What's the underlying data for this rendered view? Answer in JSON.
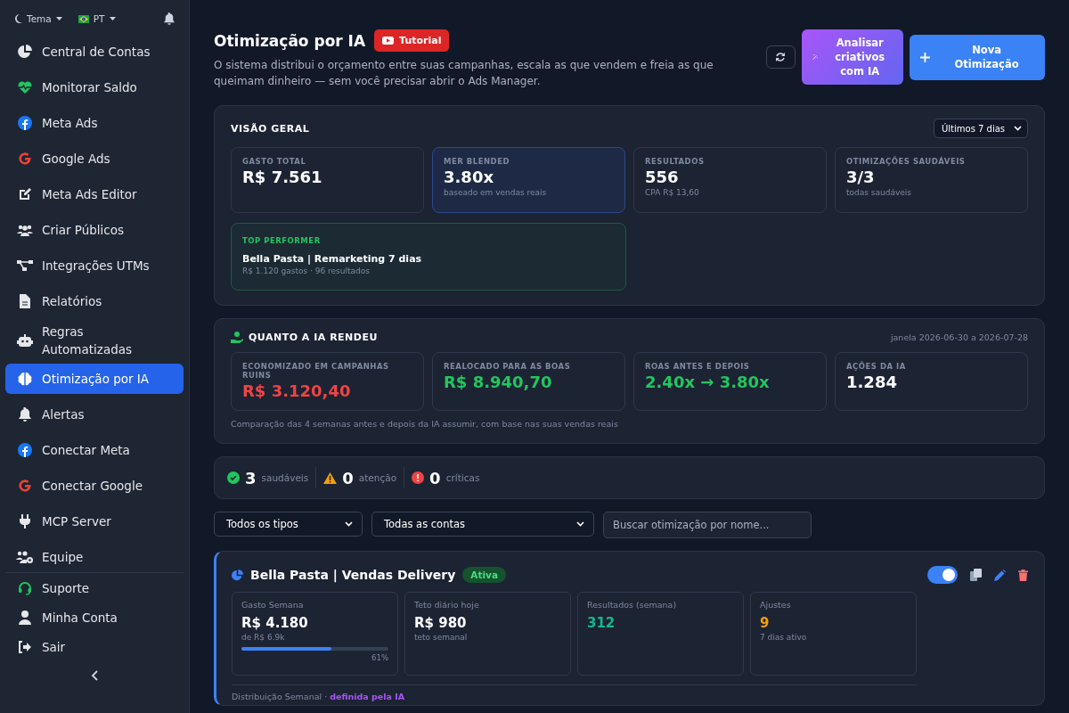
{
  "sidebar": {
    "theme": "Tema",
    "language": "PT",
    "items": [
      {
        "label": "Central de Contas",
        "selected": false
      },
      {
        "label": "Monitorar Saldo",
        "selected": false
      },
      {
        "label": "Meta Ads",
        "selected": false
      },
      {
        "label": "Google Ads",
        "selected": false
      },
      {
        "label": "Meta Ads Editor",
        "selected": false
      },
      {
        "label": "Criar Públicos",
        "selected": false
      },
      {
        "label": "Integrações UTMs",
        "selected": false
      },
      {
        "label": "Relatórios",
        "selected": false
      },
      {
        "label": "Regras Automatizadas",
        "selected": false
      },
      {
        "label": "Otimização por IA",
        "selected": true
      },
      {
        "label": "Alertas",
        "selected": false
      },
      {
        "label": "Conectar Meta",
        "selected": false
      },
      {
        "label": "Conectar Google",
        "selected": false
      },
      {
        "label": "MCP Server",
        "selected": false
      },
      {
        "label": "Equipe",
        "selected": false
      }
    ],
    "footer": [
      {
        "label": "Suporte"
      },
      {
        "label": "Minha Conta"
      },
      {
        "label": "Sair"
      }
    ]
  },
  "header": {
    "title": "Otimização por IA",
    "tutorial": "Tutorial",
    "description": "O sistema distribui o orçamento entre suas campanhas, escala as que vendem e freia as que queimam dinheiro — sem você precisar abrir o Ads Manager.",
    "analyze_button": "Analisar criativos com IA",
    "new_button": "Nova Otimização"
  },
  "overview": {
    "title": "VISÃO GERAL",
    "period": "Últimos 7 dias",
    "stats": [
      {
        "label": "GASTO TOTAL",
        "value": "R$ 7.561",
        "highlight": false
      },
      {
        "label": "MER BLENDED",
        "value": "3.80x",
        "note": "baseado em vendas reais",
        "highlight": true
      },
      {
        "label": "RESULTADOS",
        "value": "556",
        "note": "CPA R$ 13,60",
        "highlight": false
      },
      {
        "label": "OTIMIZAÇÕES SAUDÁVEIS",
        "value": "3/3",
        "note": "todas saudáveis",
        "highlight": false
      }
    ],
    "top": {
      "label": "TOP PERFORMER",
      "name": "Bella Pasta | Remarketing 7 dias",
      "note": "R$ 1.120 gastos · 96 resultados"
    }
  },
  "gains": {
    "title": "QUANTO A IA RENDEU",
    "window": "janela 2026-06-30 a 2026-07-28",
    "stats": [
      {
        "label": "ECONOMIZADO EM CAMPANHAS RUINS",
        "value": "R$ 3.120,40",
        "color": "#ef4444"
      },
      {
        "label": "REALOCADO PARA AS BOAS",
        "value": "R$ 8.940,70",
        "color": "#22c55e"
      },
      {
        "label": "ROAS ANTES E DEPOIS",
        "value": "2.40x → 3.80x",
        "color": "#22c55e"
      },
      {
        "label": "AÇÕES DA IA",
        "value": "1.284",
        "color": "#ffffff"
      }
    ],
    "note": "Comparação das 4 semanas antes e depois da IA assumir, com base nas suas vendas reais"
  },
  "health": [
    {
      "kind": "ok",
      "count": "3",
      "label": "saudáveis"
    },
    {
      "kind": "warn",
      "count": "0",
      "label": "atenção"
    },
    {
      "kind": "critical",
      "count": "0",
      "label": "críticas"
    }
  ],
  "filters": {
    "type": "Todos os tipos",
    "account": "Todas as contas",
    "search_placeholder": "Buscar otimização por nome..."
  },
  "campaign": {
    "name": "Bella Pasta | Vendas Delivery",
    "status": "Ativa",
    "on": true,
    "metrics": [
      {
        "label": "Gasto Semana",
        "value": "R$ 4.180",
        "note": "de R$ 6.9k",
        "level": 0.61,
        "percent": "61%",
        "color": "#ffffff"
      },
      {
        "label": "Teto diário hoje",
        "value": "R$ 980",
        "note": "teto semanal",
        "color": "#ffffff"
      },
      {
        "label": "Resultados (semana)",
        "value": "312",
        "color": "#14b88a"
      },
      {
        "label": "Ajustes",
        "value": "9",
        "note": "7 dias ativo",
        "color": "#f59e0b"
      }
    ],
    "distribution": "Distribuição Semanal ·",
    "distribution_note": "definida pela IA"
  }
}
